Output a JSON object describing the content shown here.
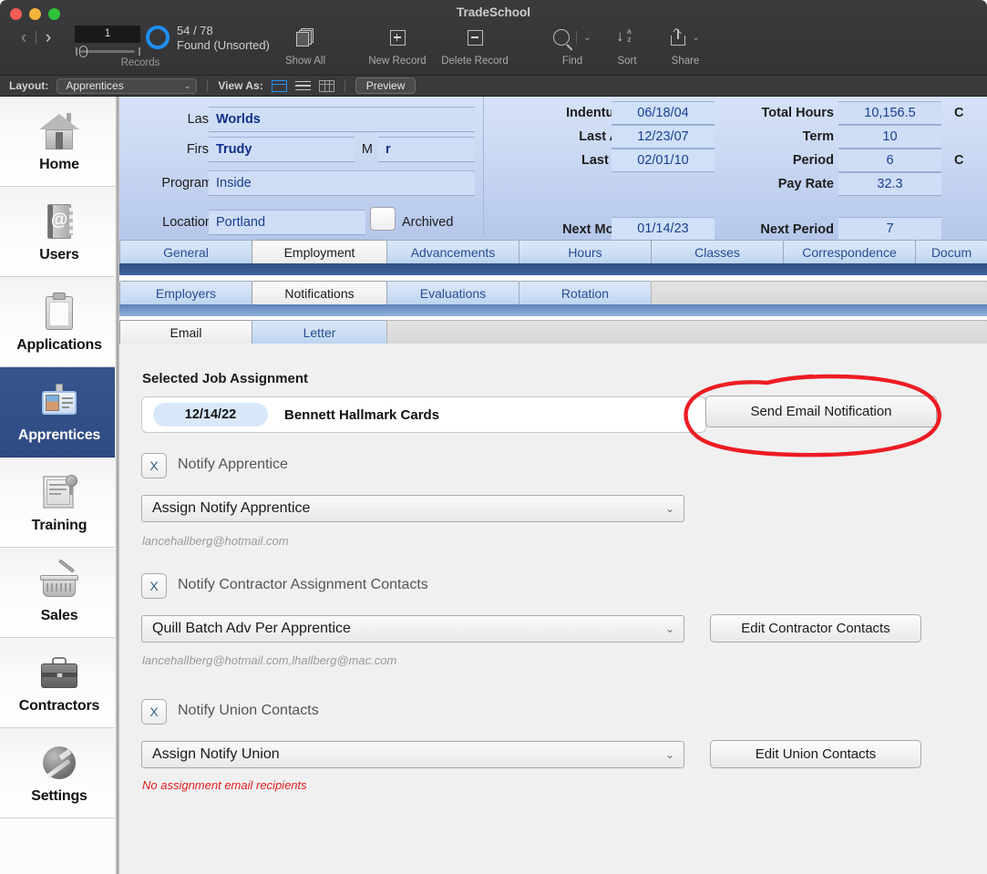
{
  "window": {
    "title": "TradeSchool"
  },
  "toolbar": {
    "record_number": "1",
    "found_count": "54 / 78",
    "found_status": "Found (Unsorted)",
    "records_label": "Records",
    "buttons": [
      {
        "name": "show-all",
        "label": "Show All"
      },
      {
        "name": "new-record",
        "label": "New Record"
      },
      {
        "name": "delete-record",
        "label": "Delete Record"
      },
      {
        "name": "find",
        "label": "Find"
      },
      {
        "name": "sort",
        "label": "Sort"
      },
      {
        "name": "share",
        "label": "Share"
      }
    ]
  },
  "layoutbar": {
    "layout_label": "Layout:",
    "layout_value": "Apprentices",
    "viewas_label": "View As:",
    "preview_label": "Preview"
  },
  "sidebar": {
    "items": [
      {
        "label": "Home",
        "icon": "home-icon",
        "selected": false
      },
      {
        "label": "Users",
        "icon": "address-book-icon",
        "selected": false
      },
      {
        "label": "Applications",
        "icon": "clipboard-icon",
        "selected": false
      },
      {
        "label": "Apprentices",
        "icon": "id-badge-icon",
        "selected": true
      },
      {
        "label": "Training",
        "icon": "certificate-icon",
        "selected": false
      },
      {
        "label": "Sales",
        "icon": "basket-icon",
        "selected": false
      },
      {
        "label": "Contractors",
        "icon": "briefcase-icon",
        "selected": false
      },
      {
        "label": "Settings",
        "icon": "tools-icon",
        "selected": false
      }
    ]
  },
  "record_header": {
    "left_fields": [
      {
        "label": "Last",
        "value": "Worlds"
      },
      {
        "label": "First",
        "value": "Trudy"
      },
      {
        "label": "M",
        "value": "r"
      },
      {
        "label": "Program",
        "value": "Inside"
      },
      {
        "label": "Location",
        "value": "Portland"
      }
    ],
    "archived_label": "Archived",
    "archived_checked": false,
    "date_fields": [
      {
        "label": "Indentured",
        "value": "06/18/04"
      },
      {
        "label": "Last Adv",
        "value": "12/23/07"
      },
      {
        "label": "Last WR",
        "value": "02/01/10"
      },
      {
        "label": "Next Month",
        "value": "01/14/23"
      }
    ],
    "num_fields": [
      {
        "label": "Total Hours",
        "value": "10,156.5"
      },
      {
        "label": "Term",
        "value": "10"
      },
      {
        "label": "Period",
        "value": "6"
      },
      {
        "label": "Pay Rate",
        "value": "32.3"
      },
      {
        "label": "Next Period",
        "value": "7"
      }
    ],
    "clipped_labels": [
      "C",
      "C"
    ]
  },
  "tabs": {
    "row1": [
      {
        "label": "General",
        "active": false
      },
      {
        "label": "Employment",
        "active": true
      },
      {
        "label": "Advancements",
        "active": false
      },
      {
        "label": "Hours",
        "active": false
      },
      {
        "label": "Classes",
        "active": false
      },
      {
        "label": "Correspondence",
        "active": false
      },
      {
        "label": "Docum",
        "active": false
      }
    ],
    "row2": [
      {
        "label": "Employers",
        "active": false
      },
      {
        "label": "Notifications",
        "active": true
      },
      {
        "label": "Evaluations",
        "active": false
      },
      {
        "label": "Rotation",
        "active": false
      }
    ],
    "row3": [
      {
        "label": "Email",
        "active": true
      },
      {
        "label": "Letter",
        "active": false
      }
    ]
  },
  "main": {
    "section_title": "Selected Job Assignment",
    "assignment": {
      "date": "12/14/22",
      "name": "Bennett Hallmark Cards"
    },
    "send_button": "Send Email Notification",
    "groups": [
      {
        "checkbox": "X",
        "label": "Notify Apprentice",
        "dropdown": "Assign Notify Apprentice",
        "recipients": "lancehallberg@hotmail.com",
        "recipients_warning": false,
        "edit_button": null
      },
      {
        "checkbox": "X",
        "label": "Notify Contractor Assignment Contacts",
        "dropdown": "Quill Batch Adv Per Apprentice",
        "recipients": "lancehallberg@hotmail.com,lhallberg@mac.com",
        "recipients_warning": false,
        "edit_button": "Edit Contractor Contacts"
      },
      {
        "checkbox": "X",
        "label": "Notify Union Contacts",
        "dropdown": "Assign Notify Union",
        "recipients": "No assignment email recipients",
        "recipients_warning": true,
        "edit_button": "Edit Union Contacts"
      }
    ]
  },
  "annotation": {
    "shape": "red-ellipse-highlight",
    "color": "#ee1c24",
    "target": "Send Email Notification"
  }
}
